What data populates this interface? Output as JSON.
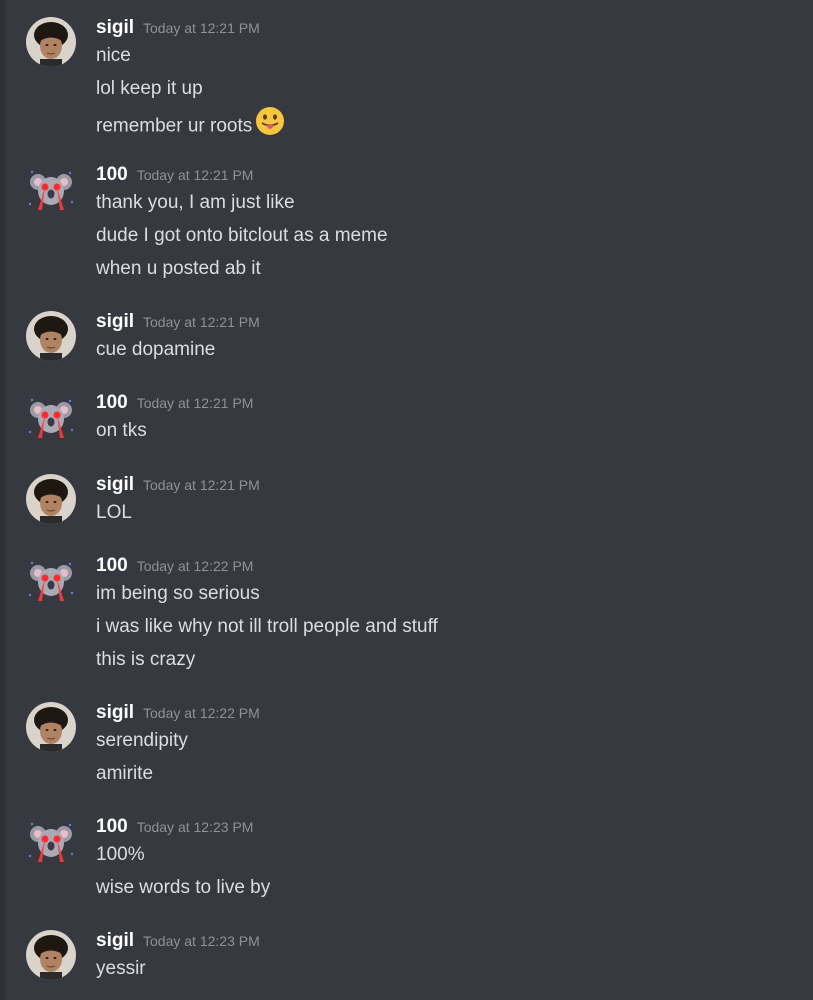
{
  "users": {
    "sigil": {
      "name": "sigil",
      "avatar_icon": "human-face-avatar"
    },
    "hundred": {
      "name": "100",
      "avatar_icon": "koala-laser-eyes-avatar"
    }
  },
  "groups": [
    {
      "user": "sigil",
      "timestamp": "Today at 12:21 PM",
      "lines": [
        "nice",
        "lol keep it up",
        "remember ur roots"
      ]
    },
    {
      "user": "100",
      "timestamp": "Today at 12:21 PM",
      "lines": [
        "thank you, I am just like",
        "dude I got onto bitclout as a meme",
        "when u posted ab it"
      ]
    },
    {
      "user": "sigil",
      "timestamp": "Today at 12:21 PM",
      "lines": [
        "cue dopamine"
      ]
    },
    {
      "user": "100",
      "timestamp": "Today at 12:21 PM",
      "lines": [
        "on tks"
      ]
    },
    {
      "user": "sigil",
      "timestamp": "Today at 12:21 PM",
      "lines": [
        "LOL"
      ]
    },
    {
      "user": "100",
      "timestamp": "Today at 12:22 PM",
      "lines": [
        "im being so serious",
        "i was like why not ill troll people and stuff",
        "this is crazy"
      ]
    },
    {
      "user": "sigil",
      "timestamp": "Today at 12:22 PM",
      "lines": [
        "serendipity",
        "amirite"
      ]
    },
    {
      "user": "100",
      "timestamp": "Today at 12:23 PM",
      "lines": [
        "100%",
        "wise words to live by"
      ]
    },
    {
      "user": "sigil",
      "timestamp": "Today at 12:23 PM",
      "lines": [
        "yessir"
      ]
    }
  ],
  "emoji": {
    "name": "tongue-out-emoji"
  },
  "colors": {
    "background": "#36393f",
    "username": "#ffffff",
    "message_text": "#dcddde",
    "timestamp": "#8e9297"
  }
}
